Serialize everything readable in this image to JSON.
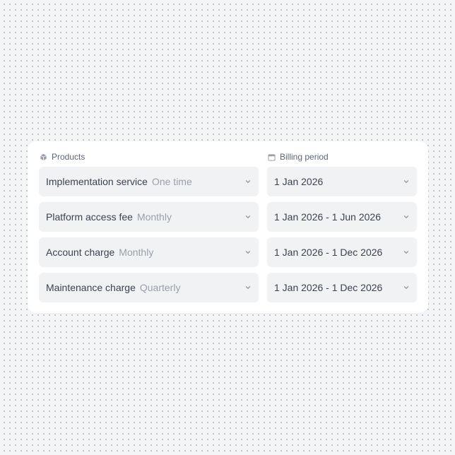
{
  "columns": {
    "products": {
      "label": "Products",
      "icon": "cube-icon"
    },
    "billing": {
      "label": "Billing period",
      "icon": "calendar-icon"
    }
  },
  "rows": [
    {
      "product": "Implementation service",
      "frequency": "One time",
      "period": "1 Jan 2026"
    },
    {
      "product": "Platform access fee",
      "frequency": "Monthly",
      "period": "1 Jan 2026 - 1 Jun 2026"
    },
    {
      "product": "Account charge",
      "frequency": "Monthly",
      "period": "1 Jan 2026 - 1 Dec 2026"
    },
    {
      "product": "Maintenance charge",
      "frequency": "Quarterly",
      "period": "1 Jan 2026 - 1 Dec 2026"
    }
  ],
  "colors": {
    "background": "#f4f5f7",
    "dots": "#b9bec7",
    "card": "#ffffff",
    "field": "#f1f2f4",
    "text_primary": "#3b4250",
    "text_muted": "#9aa0aa"
  }
}
